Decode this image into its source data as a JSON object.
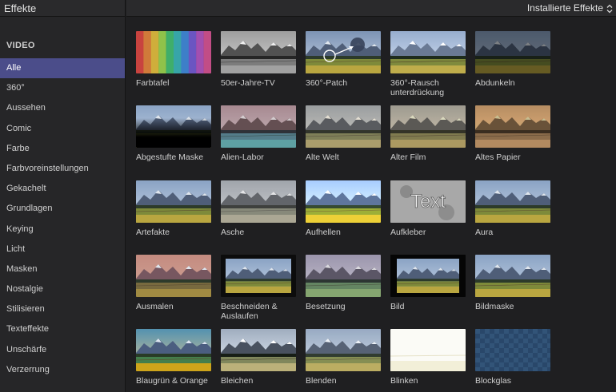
{
  "sidebar": {
    "title": "Effekte",
    "section": "VIDEO",
    "categories": [
      {
        "label": "Alle",
        "active": true
      },
      {
        "label": "360°"
      },
      {
        "label": "Aussehen"
      },
      {
        "label": "Comic"
      },
      {
        "label": "Farbe"
      },
      {
        "label": "Farbvoreinstellungen"
      },
      {
        "label": "Gekachelt"
      },
      {
        "label": "Grundlagen"
      },
      {
        "label": "Keying"
      },
      {
        "label": "Licht"
      },
      {
        "label": "Masken"
      },
      {
        "label": "Nostalgie"
      },
      {
        "label": "Stilisieren"
      },
      {
        "label": "Texteffekte"
      },
      {
        "label": "Unschärfe"
      },
      {
        "label": "Verzerrung"
      }
    ]
  },
  "header": {
    "filter_label": "Installierte Effekte",
    "filter_icon": "chevron-up-down-icon"
  },
  "effects": [
    {
      "label": "Farbtafel",
      "style": "colorbars"
    },
    {
      "label": "50er-Jahre-TV",
      "style": "gray"
    },
    {
      "label": "360°-Patch",
      "style": "patch"
    },
    {
      "label": "360°-Rausch unterdrückung",
      "style": "noise"
    },
    {
      "label": "Abdunkeln",
      "style": "dark"
    },
    {
      "label": "Abgestufte Maske",
      "style": "gradmask"
    },
    {
      "label": "Alien-Labor",
      "style": "alien"
    },
    {
      "label": "Alte Welt",
      "style": "oldworld"
    },
    {
      "label": "Alter Film",
      "style": "oldfilm"
    },
    {
      "label": "Altes Papier",
      "style": "paper"
    },
    {
      "label": "Artefakte",
      "style": "normal"
    },
    {
      "label": "Asche",
      "style": "ash"
    },
    {
      "label": "Aufhellen",
      "style": "bright"
    },
    {
      "label": "Aufkleber",
      "style": "sticker",
      "overlay_text": "Text"
    },
    {
      "label": "Aura",
      "style": "normal"
    },
    {
      "label": "Ausmalen",
      "style": "paint"
    },
    {
      "label": "Beschneiden & Auslaufen",
      "style": "crop"
    },
    {
      "label": "Besetzung",
      "style": "cast"
    },
    {
      "label": "Bild",
      "style": "frame"
    },
    {
      "label": "Bildmaske",
      "style": "normal"
    },
    {
      "label": "Blaugrün & Orange",
      "style": "teal"
    },
    {
      "label": "Bleichen",
      "style": "bleach"
    },
    {
      "label": "Blenden",
      "style": "blend"
    },
    {
      "label": "Blinken",
      "style": "white"
    },
    {
      "label": "Blockglas",
      "style": "glass"
    }
  ]
}
